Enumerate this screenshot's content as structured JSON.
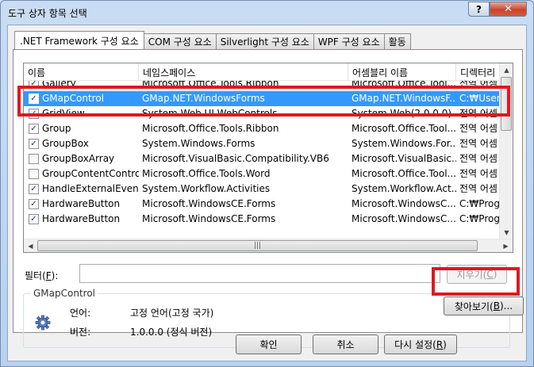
{
  "window": {
    "title": "도구 상자 항목 선택",
    "help_label": "?",
    "close_label": "✕"
  },
  "tabs": [
    {
      "label": ".NET Framework 구성 요소"
    },
    {
      "label": "COM 구성 요소"
    },
    {
      "label": "Silverlight 구성 요소"
    },
    {
      "label": "WPF 구성 요소"
    },
    {
      "label": "활동"
    }
  ],
  "list": {
    "columns": [
      "이름",
      "네임스페이스",
      "어셈블리 이름",
      "디렉터리"
    ],
    "rows": [
      {
        "name": "Gallery",
        "ns": "Microsoft.Office.Tools.Ribbon",
        "asm": "Microsoft.Office.Tool...",
        "dir": "전역 어셈",
        "checked": true,
        "selected": false
      },
      {
        "name": "GMapControl",
        "ns": "GMap.NET.WindowsForms",
        "asm": "GMap.NET.WindowsF...",
        "dir": "C:₩Users",
        "checked": true,
        "selected": true
      },
      {
        "name": "GridView",
        "ns": "System.Web.UI.WebControls",
        "asm": "System.Web(2.0.0.0)",
        "dir": "전역 어셈",
        "checked": true,
        "selected": false
      },
      {
        "name": "Group",
        "ns": "Microsoft.Office.Tools.Ribbon",
        "asm": "Microsoft.Office.Tool...",
        "dir": "전역 어셈",
        "checked": true,
        "selected": false
      },
      {
        "name": "GroupBox",
        "ns": "System.Windows.Forms",
        "asm": "System.Windows.For...",
        "dir": "전역 어셈",
        "checked": true,
        "selected": false
      },
      {
        "name": "GroupBoxArray",
        "ns": "Microsoft.VisualBasic.Compatibility.VB6",
        "asm": "Microsoft.VisualBasic...",
        "dir": "전역 어셈",
        "checked": false,
        "selected": false
      },
      {
        "name": "GroupContentControl",
        "ns": "Microsoft.Office.Tools.Word",
        "asm": "Microsoft.Office.Tool...",
        "dir": "전역 어셈",
        "checked": false,
        "selected": false
      },
      {
        "name": "HandleExternalEvent",
        "ns": "System.Workflow.Activities",
        "asm": "System.Workflow.Act...",
        "dir": "전역 어셈",
        "checked": true,
        "selected": false
      },
      {
        "name": "HardwareButton",
        "ns": "Microsoft.WindowsCE.Forms",
        "asm": "Microsoft.WindowsC...",
        "dir": "C:₩Prog",
        "checked": true,
        "selected": false
      },
      {
        "name": "HardwareButton",
        "ns": "Microsoft.WindowsCE.Forms",
        "asm": "Microsoft.WindowsC...",
        "dir": "C:₩Prog",
        "checked": true,
        "selected": false
      }
    ]
  },
  "filter": {
    "label": "필터(",
    "key": "F",
    "label_end": "):",
    "value": "",
    "clear_label": "지우기(",
    "clear_key": "C",
    "clear_end": ")"
  },
  "details": {
    "group_title": "GMapControl",
    "language_label": "언어:",
    "language_value": "고정 언어(고정 국가)",
    "version_label": "버전:",
    "version_value": "1.0.0.0 (정식 버전)"
  },
  "buttons": {
    "browse_label": "찾아보기(",
    "browse_key": "B",
    "browse_end": ")...",
    "ok_label": "확인",
    "cancel_label": "취소",
    "reset_label": "다시 설정(",
    "reset_key": "R",
    "reset_end": ")"
  },
  "colors": {
    "selection": "#3399ff",
    "highlight_box": "#e0181f"
  },
  "icons": {
    "assembly": "gear-icon",
    "scroll_grip": "grip-icon"
  }
}
